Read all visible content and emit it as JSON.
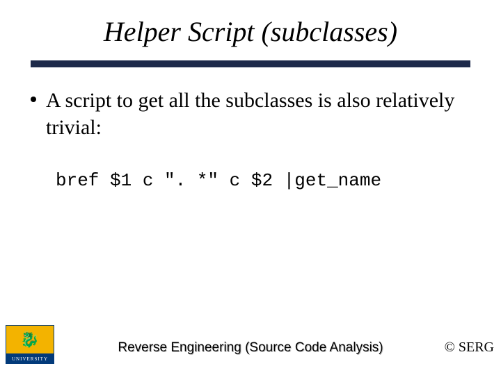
{
  "title": "Helper Script (subclasses)",
  "bullet": "A script to get all the subclasses is also relatively trivial:",
  "code": "bref $1 c \". *\" c $2 |get_name",
  "footer_title": "Reverse Engineering (Source Code Analysis)",
  "copyright": "© SERG",
  "logo": {
    "top_glyph": "🐉",
    "bottom_text": "UNIVERSITY"
  }
}
